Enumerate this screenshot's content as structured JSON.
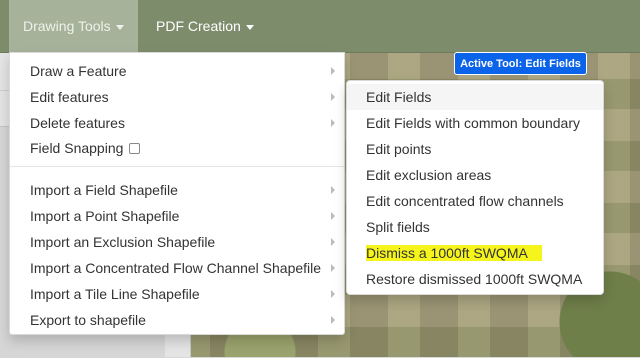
{
  "navbar": {
    "drawing_tools_label": "Drawing Tools",
    "pdf_creation_label": "PDF Creation"
  },
  "active_tool_badge": "Active Tool: Edit Fields",
  "drawing_menu": {
    "items": [
      {
        "label": "Draw a Feature"
      },
      {
        "label": "Edit features"
      },
      {
        "label": "Delete features"
      },
      {
        "label": "Field Snapping"
      },
      {
        "label": "Import a Field Shapefile"
      },
      {
        "label": "Import a Point Shapefile"
      },
      {
        "label": "Import an Exclusion Shapefile"
      },
      {
        "label": "Import a Concentrated Flow Channel Shapefile"
      },
      {
        "label": "Import a Tile Line Shapefile"
      },
      {
        "label": "Export to shapefile"
      }
    ]
  },
  "edit_submenu": {
    "items": [
      {
        "label": "Edit Fields"
      },
      {
        "label": "Edit Fields with common boundary"
      },
      {
        "label": "Edit points"
      },
      {
        "label": "Edit exclusion areas"
      },
      {
        "label": "Edit concentrated flow channels"
      },
      {
        "label": "Split fields"
      },
      {
        "label": "Dismiss a 1000ft SWQMA"
      },
      {
        "label": "Restore dismissed 1000ft SWQMA"
      }
    ]
  },
  "colors": {
    "navbar": "#7d8d6c",
    "badge": "#0a63e8",
    "highlight": "#f5f51d"
  }
}
